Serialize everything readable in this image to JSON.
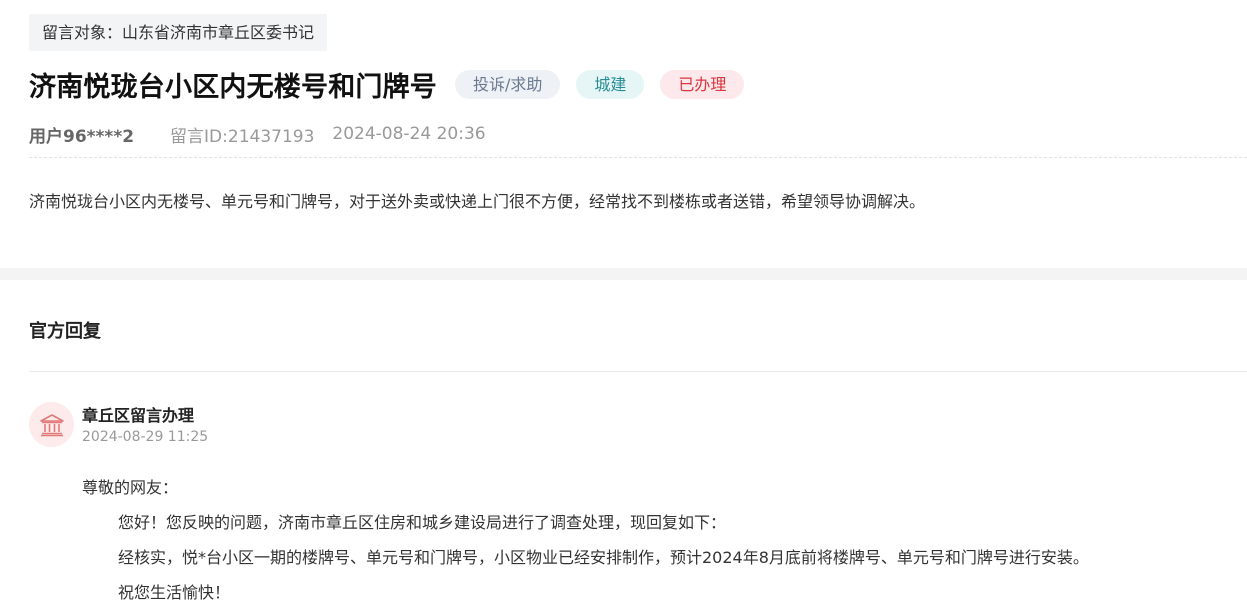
{
  "message": {
    "target": "留言对象：山东省济南市章丘区委书记",
    "title": "济南悦珑台小区内无楼号和门牌号",
    "tags": {
      "type": "投诉/求助",
      "category": "城建",
      "status": "已办理"
    },
    "user": "用户96****2",
    "message_id": "留言ID:21437193",
    "datetime": "2024-08-24 20:36",
    "content": "济南悦珑台小区内无楼号、单元号和门牌号，对于送外卖或快递上门很不方便，经常找不到楼栋或者送错，希望领导协调解决。"
  },
  "reply": {
    "heading": "官方回复",
    "department": "章丘区留言办理",
    "datetime": "2024-08-29 11:25",
    "avatar_icon": "government-building-icon",
    "greeting": "尊敬的网友：",
    "paragraphs": [
      "您好！您反映的问题，济南市章丘区住房和城乡建设局进行了调查处理，现回复如下：",
      "经核实，悦*台小区一期的楼牌号、单元号和门牌号，小区物业已经安排制作，预计2024年8月底前将楼牌号、单元号和门牌号进行安装。",
      "祝您生活愉快！"
    ]
  },
  "colors": {
    "status_red": "#d9363e",
    "category_teal": "#2a8d95",
    "type_gray": "#6b7a90",
    "avatar_bg": "#fdeaea",
    "avatar_icon": "#e07a7a"
  }
}
